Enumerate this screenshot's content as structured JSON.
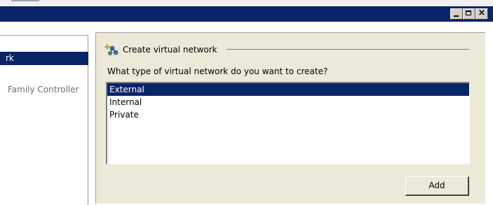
{
  "window": {
    "controls": {
      "minimize": "minimize",
      "maximize": "maximize",
      "close": "close"
    }
  },
  "sidebar": {
    "items": [
      {
        "label": "rk",
        "selected": true
      },
      {
        "label": "Family Controller",
        "selected": false
      }
    ]
  },
  "main": {
    "section_title": "Create virtual network",
    "question": "What type of virtual network do you want to create?",
    "network_types": [
      {
        "label": "External",
        "selected": true
      },
      {
        "label": "Internal",
        "selected": false
      },
      {
        "label": "Private",
        "selected": false
      }
    ],
    "add_label": "Add"
  },
  "colors": {
    "titlebar": "#0a246a",
    "selection": "#0a246a",
    "panel": "#ece9d8"
  }
}
